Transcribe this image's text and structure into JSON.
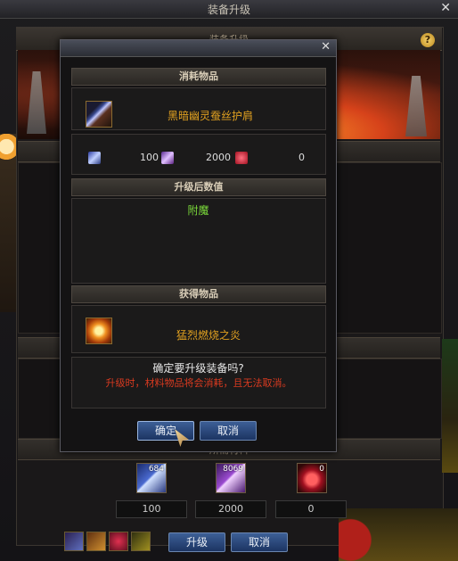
{
  "background": {
    "window_title": "装备升级",
    "close_glyph": "✕",
    "header_text": "装备升级",
    "help_glyph": "?",
    "materials_label": "所需材料",
    "materials": [
      {
        "count_label": "684",
        "quantity": "100",
        "icon": "blue-crystal-icon"
      },
      {
        "count_label": "8069",
        "quantity": "2000",
        "icon": "purple-crystal-icon"
      },
      {
        "count_label": "0",
        "quantity": "0",
        "icon": "red-gem-icon"
      }
    ],
    "upgrade_button": "升级",
    "cancel_button": "取消"
  },
  "modal": {
    "close_glyph": "✕",
    "consume_header": "消耗物品",
    "consume_item_name": "黑暗幽灵蚕丝护肩",
    "costs": [
      {
        "value": "100",
        "icon": "blue-crystal-icon"
      },
      {
        "value": "2000",
        "icon": "purple-crystal-icon"
      },
      {
        "value": "0",
        "icon": "red-gem-icon"
      }
    ],
    "after_header": "升级后数值",
    "after_value": "附魔",
    "obtain_header": "获得物品",
    "obtain_item_name": "猛烈燃烧之炎",
    "confirm_question": "确定要升级装备吗?",
    "warning_text": "升级时，材料物品将会消耗，且无法取消。",
    "ok_button": "确定",
    "cancel_button": "取消"
  }
}
